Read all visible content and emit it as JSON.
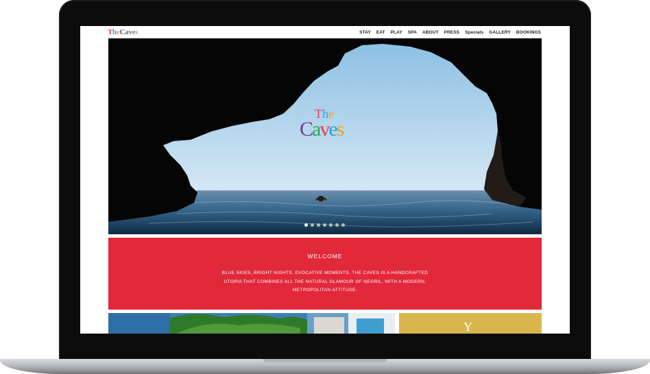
{
  "site": {
    "logo": {
      "letters": [
        "T",
        "h",
        "e",
        "C",
        "a",
        "v",
        "e",
        "s"
      ],
      "colors": [
        "#e93a54",
        "#2aa2dc",
        "#f3a21a",
        "#7b3c97",
        "#24a65a",
        "#e93a54",
        "#2aa2dc",
        "#f3a21a"
      ]
    },
    "nav": [
      "STAY",
      "EAT",
      "PLAY",
      "SPA",
      "ABOUT",
      "PRESS",
      "Specials",
      "GALLERY",
      "BOOKINGS"
    ]
  },
  "hero": {
    "logo_the": "The",
    "logo_caves": "Caves",
    "slides": 7,
    "active_slide": 0
  },
  "welcome": {
    "heading": "WELCOME",
    "text": "BLUE SKIES, BRIGHT NIGHTS, EVOCATIVE MOMENTS. THE CAVES IS A HANDCRAFTED UTOPIA THAT COMBINES ALL THE NATURAL GLAMOUR OF NEGRIL, WITH A MODERN, METROPOLITAN ATTITUDE.",
    "color": "#e2283b"
  },
  "tiles": {
    "right_color": "#d9b64c"
  }
}
